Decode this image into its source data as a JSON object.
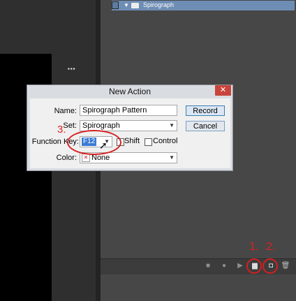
{
  "actions_panel": {
    "set_name": "Spirograph",
    "controls": [
      "stop-icon",
      "record-icon",
      "play-icon",
      "folder-icon",
      "new-action-icon",
      "trash-icon"
    ]
  },
  "annotations": {
    "step1": "1.",
    "step2": "2.",
    "step3": "3."
  },
  "dialog": {
    "title": "New Action",
    "close_glyph": "✕",
    "name_label": "Name:",
    "name_value": "Spirograph Pattern",
    "set_label": "Set:",
    "set_value": "Spirograph",
    "function_key_label": "Function Key:",
    "function_key_value": "F12",
    "shift_label": "Shift",
    "control_label": "Control",
    "color_label": "Color:",
    "color_value": "None",
    "record_label": "Record",
    "cancel_label": "Cancel"
  },
  "colors": {
    "annotation_red": "#d71f1f",
    "selected_set_row": "#6e8db4",
    "close_button": "#c9443c"
  }
}
